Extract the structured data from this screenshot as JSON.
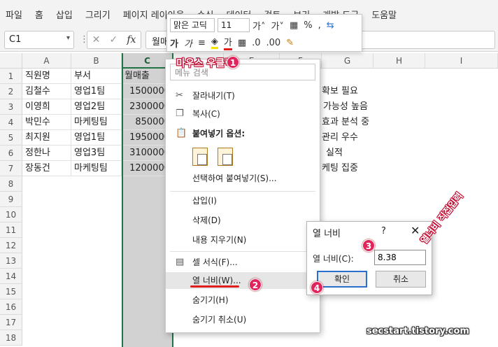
{
  "ribbon": {
    "tabs": [
      "파일",
      "홈",
      "삽입",
      "그리기",
      "페이지 레이아웃",
      "수식",
      "데이터",
      "검토",
      "보기",
      "개발 도구",
      "도움말"
    ]
  },
  "formula_bar": {
    "name_box": "C1",
    "formula": "월매출"
  },
  "columns": [
    "A",
    "B",
    "C",
    "D",
    "E",
    "F",
    "G",
    "H",
    "I"
  ],
  "rows": [
    "1",
    "2",
    "3",
    "4",
    "5",
    "6",
    "7",
    "8",
    "9",
    "10",
    "11",
    "12",
    "13",
    "14",
    "15",
    "16",
    "17",
    "18"
  ],
  "cells": {
    "r1": [
      "직원명",
      "부서",
      "월매출"
    ],
    "r2": [
      "김철수",
      "영업1팀",
      "1500000"
    ],
    "r3": [
      "이영희",
      "영업2팀",
      "2300000"
    ],
    "r4": [
      "박민수",
      "마케팅팀",
      "850000"
    ],
    "r5": [
      "최지원",
      "영업1팀",
      "1950000"
    ],
    "r6": [
      "정한나",
      "영업3팀",
      "3100000"
    ],
    "r7": [
      "장동건",
      "마케팅팀",
      "1200000"
    ]
  },
  "overflow_texts": [
    "확보 필요",
    "가능성 높음",
    "효과 분석 중",
    "관리 우수",
    "실적",
    "케팅 집중"
  ],
  "mini_toolbar": {
    "font_name": "맑은 고딕",
    "font_size": "11",
    "bold": "가",
    "italic": "가",
    "percent": "%",
    "comma": ","
  },
  "context_menu": {
    "search_placeholder": "메뉴 검색",
    "cut": "잘라내기(T)",
    "copy": "복사(C)",
    "paste_options": "붙여넣기 옵션:",
    "paste_special": "선택하여 붙여넣기(S)...",
    "insert": "삽입(I)",
    "delete": "삭제(D)",
    "clear": "내용 지우기(N)",
    "format_cells": "셀 서식(F)...",
    "column_width": "열 너비(W)...",
    "hide": "숨기기(H)",
    "unhide": "숨기기 취소(U)"
  },
  "dialog": {
    "title": "열 너비",
    "help": "?",
    "close": "✕",
    "label": "열 너비(C):",
    "value": "8.38",
    "ok": "확인",
    "cancel": "취소"
  },
  "annotations": {
    "right_click": "마우스 우클릭",
    "direct_input": "열너비 직접입력",
    "badge1": "1",
    "badge2": "2",
    "badge3": "3",
    "badge4": "4",
    "watermark": "secstart.tistory.com"
  },
  "colors": {
    "accent": "#217346",
    "badge": "#e0245e",
    "selection": "#d2d2d2"
  }
}
